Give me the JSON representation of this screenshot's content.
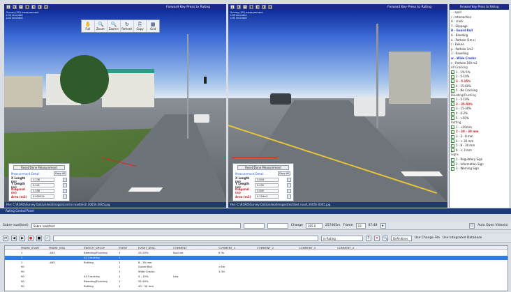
{
  "left_pane": {
    "overlay_lines": [
      "Survey (SG) measurement",
      "LHS recorded",
      "LHS recorded"
    ],
    "toolbar": [
      {
        "label": "Full",
        "icon": "hand-icon",
        "glyph": "✋"
      },
      {
        "label": "Zoom-",
        "icon": "zoom-out-icon",
        "glyph": "🔍"
      },
      {
        "label": "Zoom+",
        "icon": "zoom-in-icon",
        "glyph": "🔍"
      },
      {
        "label": "Refresh",
        "icon": "refresh-icon",
        "glyph": "↻"
      },
      {
        "label": "Copy",
        "icon": "copy-icon",
        "glyph": "⎘"
      },
      {
        "label": "Grid",
        "icon": "grid-icon",
        "glyph": "▦"
      }
    ],
    "title": "Forward Key Press to Rating",
    "status": "File: C:\\ROAD\\Survey Data\\video\\Images\\centre road\\test\\ 2005h.0005.jpg",
    "measure": {
      "reset": "Reset/Done Measurement",
      "heading": "Measurement Detail",
      "copy": "Copy All",
      "rows": [
        {
          "label": "X Length (m)",
          "value": "1.136"
        },
        {
          "label": "Y Length (m)",
          "value": "0.541"
        },
        {
          "label": "Diagonal (m)",
          "value": "1.258"
        },
        {
          "label": "Area (m2)",
          "value": "0.000024"
        }
      ]
    }
  },
  "right_pane": {
    "overlay_lines": [
      "Survey (SG) measurement",
      "LHS recorded",
      "LHS recorded"
    ],
    "title": "Forward Key Press to Rating",
    "status": "File: C:\\ROAD\\Survey Data\\video\\Images\\test\\test road\\ 2005h.0005.jpg",
    "measure": {
      "reset": "Reset/Done Measurement",
      "heading": "Measurement Detail",
      "copy": "Copy All",
      "rows": [
        {
          "label": "X Length (m)",
          "value": "2.844"
        },
        {
          "label": "Y Length (m)",
          "value": "0.076"
        },
        {
          "label": "Diagonal (m)",
          "value": "2.845"
        },
        {
          "label": "Area (m2)",
          "value": "0.216m2"
        }
      ]
    }
  },
  "sidebar": {
    "title": "Forward Key Press to Rating",
    "items": [
      {
        "text": "- - spall",
        "style": ""
      },
      {
        "text": "/ - Intersection",
        "style": ""
      },
      {
        "text": "A - crack",
        "style": ""
      },
      {
        "text": "7 - Slippage",
        "style": ""
      },
      {
        "text": "B - Guard Rail",
        "style": "bold"
      },
      {
        "text": "A - Bleeding",
        "style": ""
      },
      {
        "text": "a - Pothole (1m+)",
        "style": ""
      },
      {
        "text": "r - Failure",
        "style": ""
      },
      {
        "text": "p - Pothole 1m2",
        "style": ""
      },
      {
        "text": "1 - Ravelling",
        "style": ""
      },
      {
        "text": "w - Wide Cracks",
        "style": "bold"
      },
      {
        "text": "c - Pothole 100 m2",
        "style": ""
      },
      {
        "text": "All Cracking",
        "style": "group"
      },
      {
        "text": "1 - 1% 5%",
        "style": "box"
      },
      {
        "text": "2 - 5-10%",
        "style": "box"
      },
      {
        "text": "3 - 5-15%",
        "style": "boxred"
      },
      {
        "text": "4 - 15-60%",
        "style": "box"
      },
      {
        "text": "5 - No Cracking",
        "style": "box"
      },
      {
        "text": "Bleeding/Flushing",
        "style": "group"
      },
      {
        "text": "1 - 5-10%",
        "style": "box"
      },
      {
        "text": "2 - 25-50%",
        "style": "boxred"
      },
      {
        "text": "3 - 15-30%",
        "style": "box"
      },
      {
        "text": "4 - 0-2%",
        "style": "box"
      },
      {
        "text": "5 - >50%",
        "style": "box"
      },
      {
        "text": "Rutting",
        "style": "group"
      },
      {
        "text": "1 - <20mm",
        "style": "box"
      },
      {
        "text": "2 - 20 - 30 mm",
        "style": "boxred"
      },
      {
        "text": "3 - 3 - 8 mm",
        "style": "box"
      },
      {
        "text": "4 - > 30 mm",
        "style": "box"
      },
      {
        "text": "5 - 8 - 30 mm",
        "style": "box"
      },
      {
        "text": "6 - < 3 mm",
        "style": "box"
      },
      {
        "text": "Signs",
        "style": "group"
      },
      {
        "text": "1 - Regulatory Sign",
        "style": "box"
      },
      {
        "text": "2 - Information Sign",
        "style": "box"
      },
      {
        "text": "3 - Warning Sign",
        "style": "box"
      }
    ]
  },
  "mid_strip": "Rating Control Panel",
  "controls1": {
    "road_label": "Sabre road(test)",
    "road_value": "Sabre road/test",
    "change_label": "Change",
    "change_value": "265.0",
    "change_value2": "257465m",
    "frame_label": "Frame",
    "frame_value": "03",
    "frame_value2": "07:49",
    "auto_label": "Auto Open Video(s)"
  },
  "controls2": {
    "rating_value": "in Rating",
    "definitions": "Definitions",
    "use_file": "Use Change File",
    "use_db": "Use Integrated Database"
  },
  "grid": {
    "columns": [
      "FRAME_START",
      "FRAME_END",
      "SWITCH_GROUP",
      "EVENT",
      "EVENT_DESC",
      "COMMENT",
      "COMMENT_1",
      "COMMENT_2",
      "COMMENT_3",
      "COMMENT_4"
    ],
    "rows": [
      [
        "1",
        "-463",
        "Bleeding/Flushing",
        "1",
        "25-50%",
        "Nuclure",
        "6 3s",
        "",
        "",
        ""
      ],
      [
        "1",
        "",
        "All Cracking",
        "1",
        "",
        "",
        "",
        "",
        "",
        ""
      ],
      [
        "1",
        "-463",
        "Rutting",
        "1",
        "8 - 30 mm",
        "",
        "",
        "",
        "",
        ""
      ],
      [
        "90",
        "",
        "",
        "1",
        "Guard Rail",
        "",
        ">3m",
        "",
        "",
        ""
      ],
      [
        "90",
        "",
        "",
        "1",
        "Wide Cracks",
        "",
        "1-3d",
        "",
        "",
        ""
      ],
      [
        "90",
        "",
        "All Cracking",
        "1",
        "5 - 15%",
        "Low",
        "",
        "",
        "",
        ""
      ],
      [
        "90",
        "",
        "Bleeding/Flushing",
        "1",
        "25-50%",
        "",
        "",
        "",
        "",
        ""
      ],
      [
        "90",
        "",
        "Rutting",
        "1",
        "20 - 30 mm",
        "",
        "",
        "",
        "",
        ""
      ]
    ],
    "selected_row": 1
  }
}
